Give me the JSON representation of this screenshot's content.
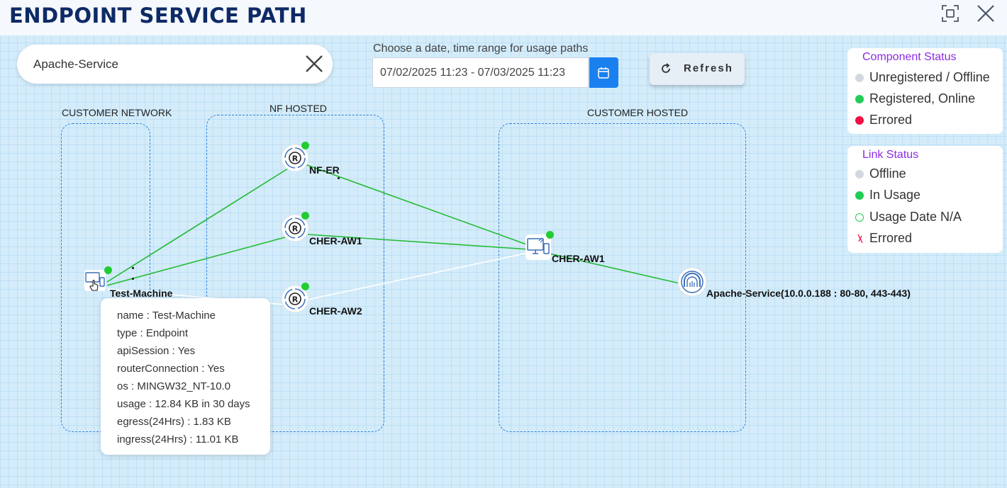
{
  "header": {
    "title": "ENDPOINT SERVICE PATH"
  },
  "search": {
    "value": "Apache-Service"
  },
  "date_range": {
    "label": "Choose a date, time range for usage paths",
    "value": "07/02/2025 11:23 - 07/03/2025 11:23"
  },
  "refresh": {
    "label": "Refresh"
  },
  "component_status": {
    "title": "Component Status",
    "items": [
      {
        "label": "Unregistered / Offline",
        "color": "#d3d8e0"
      },
      {
        "label": "Registered, Online",
        "color": "#22cc55"
      },
      {
        "label": "Errored",
        "color": "#ee1144"
      }
    ]
  },
  "link_status": {
    "title": "Link Status",
    "items": [
      {
        "label": "Offline",
        "color": "#d3d8e0"
      },
      {
        "label": "In Usage",
        "color": "#22cc55"
      },
      {
        "label": "Usage Date N/A",
        "color": "#22cc55"
      },
      {
        "label": "Errored",
        "color": "#ee1144"
      }
    ]
  },
  "zones": {
    "customer_network": "CUSTOMER NETWORK",
    "nf_hosted": "NF HOSTED",
    "customer_hosted": "CUSTOMER HOSTED"
  },
  "nodes": {
    "test_machine": "Test-Machine",
    "nf_er": "NF-ER",
    "cher_aw1_router": "CHER-AW1",
    "cher_aw2": "CHER-AW2",
    "cher_aw1_host": "CHER-AW1",
    "apache_service": "Apache-Service(10.0.0.188 : 80-80, 443-443)"
  },
  "tooltip": {
    "rows": [
      "name  :  Test-Machine",
      "type  :  Endpoint",
      "apiSession  :  Yes",
      "routerConnection  :  Yes",
      "os  :  MINGW32_NT-10.0",
      "usage  :  12.84 KB in 30 days",
      "egress(24Hrs)  :  1.83 KB",
      "ingress(24Hrs)  :  11.01 KB"
    ]
  },
  "colors": {
    "online": "#22cc33",
    "link_in_usage": "#22bb33",
    "link_offline": "#ffffff",
    "zone_border": "#2f7fd8",
    "title": "#0e2a66",
    "accent_button": "#1a80f0"
  }
}
